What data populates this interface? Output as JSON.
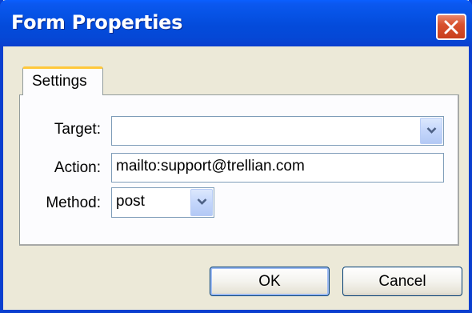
{
  "window": {
    "title": "Form Properties"
  },
  "tabs": [
    {
      "label": "Settings",
      "selected": true
    }
  ],
  "form": {
    "target": {
      "label": "Target:",
      "value": ""
    },
    "action": {
      "label": "Action:",
      "value": "mailto:support@trellian.com"
    },
    "method": {
      "label": "Method:",
      "value": "post"
    }
  },
  "buttons": {
    "ok_label": "OK",
    "cancel_label": "Cancel"
  },
  "icons": {
    "close": "close-icon",
    "dropdown": "chevron-down-icon"
  },
  "colors": {
    "titlebar": "#0a4fdc",
    "close_button": "#d8512e",
    "dialog_background": "#ece9d8",
    "tab_highlight": "#ffc83c"
  }
}
